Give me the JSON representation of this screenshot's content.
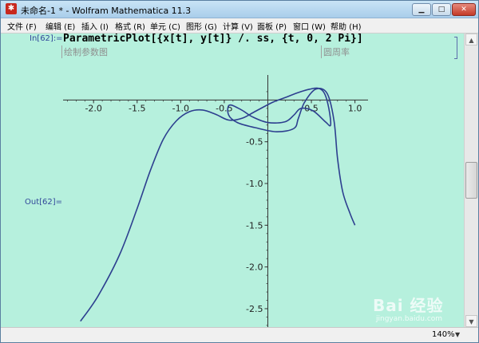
{
  "window": {
    "title": "未命名-1 * - Wolfram Mathematica 11.3",
    "app_icon": "mathematica-logo-icon",
    "controls": {
      "minimize": "▁",
      "maximize": "□",
      "close": "✕"
    }
  },
  "menu": {
    "items": [
      "文件 (F)",
      "编辑 (E)",
      "插入 (I)",
      "格式 (R)",
      "单元 (C)",
      "图形 (G)",
      "计算 (V)",
      "面板 (P)",
      "窗口 (W)",
      "帮助 (H)"
    ]
  },
  "notebook": {
    "input_label": "In[62]:=",
    "input_code": "ParametricPlot[{x[t], y[t]} /. ss, {t, 0, 2 Pi}]",
    "hint_left": "绘制参数图",
    "hint_right": "圆周率",
    "output_label": "Out[62]="
  },
  "chart_data": {
    "type": "line",
    "x_ticks": [
      "-2.0",
      "-1.5",
      "-1.0",
      "-0.5",
      "0.5",
      "1.0"
    ],
    "y_ticks": [
      "-0.5",
      "-1.0",
      "-1.5",
      "-2.0",
      "-2.5"
    ],
    "xlim": [
      -2.35,
      1.15
    ],
    "ylim": [
      -2.72,
      0.3
    ],
    "color": "#2d3f8f",
    "series": [
      {
        "points": [
          [
            -2.15,
            -2.65
          ],
          [
            -1.95,
            -2.35
          ],
          [
            -1.7,
            -1.85
          ],
          [
            -1.5,
            -1.3
          ],
          [
            -1.35,
            -0.85
          ],
          [
            -1.2,
            -0.47
          ],
          [
            -1.05,
            -0.25
          ],
          [
            -0.9,
            -0.14
          ],
          [
            -0.75,
            -0.12
          ],
          [
            -0.6,
            -0.17
          ],
          [
            -0.45,
            -0.24
          ],
          [
            -0.3,
            -0.22
          ],
          [
            -0.15,
            -0.14
          ],
          [
            0.05,
            -0.03
          ],
          [
            0.2,
            0.03
          ],
          [
            0.35,
            0.09
          ],
          [
            0.48,
            0.13
          ],
          [
            0.58,
            0.14
          ],
          [
            0.65,
            0.08
          ],
          [
            0.7,
            -0.1
          ],
          [
            0.72,
            -0.3
          ],
          [
            0.66,
            -0.26
          ],
          [
            0.52,
            -0.13
          ],
          [
            0.38,
            -0.1
          ],
          [
            0.3,
            -0.18
          ],
          [
            0.2,
            -0.26
          ],
          [
            0.0,
            -0.27
          ],
          [
            -0.18,
            -0.2
          ],
          [
            -0.3,
            -0.12
          ],
          [
            -0.44,
            -0.06
          ],
          [
            -0.45,
            -0.18
          ],
          [
            -0.35,
            -0.27
          ],
          [
            -0.15,
            -0.33
          ],
          [
            0.1,
            -0.38
          ],
          [
            0.3,
            -0.34
          ],
          [
            0.35,
            -0.22
          ],
          [
            0.42,
            -0.03
          ],
          [
            0.55,
            0.13
          ],
          [
            0.68,
            0.08
          ],
          [
            0.76,
            -0.25
          ],
          [
            0.8,
            -0.7
          ],
          [
            0.86,
            -1.1
          ],
          [
            0.94,
            -1.35
          ],
          [
            1.0,
            -1.5
          ]
        ]
      }
    ]
  },
  "scrollbar": {
    "up": "▲",
    "down": "▼"
  },
  "status": {
    "zoom": "140%",
    "zoom_arrow": "▼"
  },
  "watermark": {
    "text": "Bai 经验",
    "sub": "jingyan.baidu.com"
  }
}
